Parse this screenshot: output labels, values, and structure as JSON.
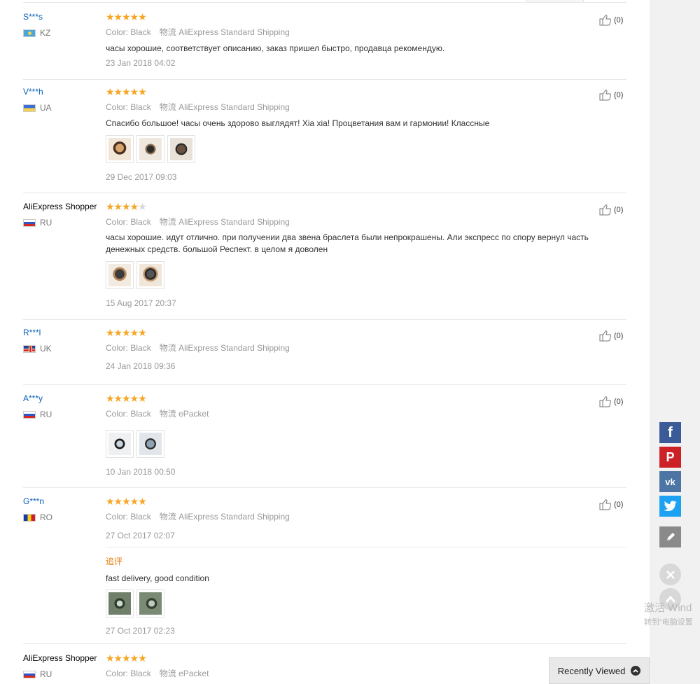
{
  "reviews": [
    {
      "user": "S***s",
      "country": "KZ",
      "flag": "kz",
      "stars": 5,
      "likes": "(0)",
      "color_label": "Color:",
      "color_value": "Black",
      "shipping_label": "物流",
      "shipping_value": "AliExpress Standard Shipping",
      "text": "часы хорошие, соответствует описанию, заказ пришел быстро, продавца рекомендую.",
      "date": "23 Jan 2018 04:02"
    },
    {
      "user": "V***h",
      "country": "UA",
      "flag": "ua",
      "stars": 5,
      "likes": "(0)",
      "color_label": "Color:",
      "color_value": "Black",
      "shipping_label": "物流",
      "shipping_value": "AliExpress Standard Shipping",
      "text": "Спасибо большое! часы очень здорово выглядят! Xia xia! Процветания вам и гармонии! Классные",
      "date": "29 Dec 2017 09:03"
    },
    {
      "user": "AliExpress Shopper",
      "country": "RU",
      "flag": "ru",
      "stars": 4,
      "likes": "(0)",
      "color_label": "Color:",
      "color_value": "Black",
      "shipping_label": "物流",
      "shipping_value": "AliExpress Standard Shipping",
      "text": "часы хорошие. идут отлично. при получении два звена браслета были непрокрашены. Али экспресс по спору вернул часть денежных средств. большой Респект. в целом я доволен",
      "date": "15 Aug 2017 20:37"
    },
    {
      "user": "R***l",
      "country": "UK",
      "flag": "uk",
      "stars": 5,
      "likes": "(0)",
      "color_label": "Color:",
      "color_value": "Black",
      "shipping_label": "物流",
      "shipping_value": "AliExpress Standard Shipping",
      "date": "24 Jan 2018 09:36"
    },
    {
      "user": "A***y",
      "country": "RU",
      "flag": "ru",
      "stars": 5,
      "likes": "(0)",
      "color_label": "Color:",
      "color_value": "Black",
      "shipping_label": "物流",
      "shipping_value": "ePacket",
      "date": "10 Jan 2018 00:50"
    },
    {
      "user": "G***n",
      "country": "RO",
      "flag": "ro",
      "stars": 5,
      "likes": "(0)",
      "color_label": "Color:",
      "color_value": "Black",
      "shipping_label": "物流",
      "shipping_value": "AliExpress Standard Shipping",
      "date": "27 Oct 2017 02:07",
      "followup_label": "追评",
      "followup_text": "fast delivery, good condition",
      "followup_date": "27 Oct 2017 02:23"
    },
    {
      "user": "AliExpress Shopper",
      "country": "RU",
      "flag": "ru",
      "stars": 5,
      "likes": "(0)",
      "color_label": "Color:",
      "color_value": "Black",
      "shipping_label": "物流",
      "shipping_value": "ePacket"
    }
  ],
  "share": {
    "facebook": "f",
    "pinterest": "P",
    "vk": "vk"
  },
  "watermark": {
    "line1": "激活 Wind",
    "line2": "转到“电脑设置"
  },
  "recently_viewed": "Recently Viewed",
  "colors": {
    "star": "#f5a623",
    "username": "#0b5fb8",
    "followup": "#e8790a",
    "facebook": "#3b5b98",
    "pinterest": "#cc2127",
    "vk": "#4c75a3",
    "twitter": "#1da1f2"
  },
  "icons": [
    "thumbs-up-icon",
    "flag-icon",
    "star-icon",
    "facebook-icon",
    "pinterest-icon",
    "vk-icon",
    "twitter-icon",
    "pencil-icon",
    "close-icon",
    "chevron-up-icon"
  ]
}
